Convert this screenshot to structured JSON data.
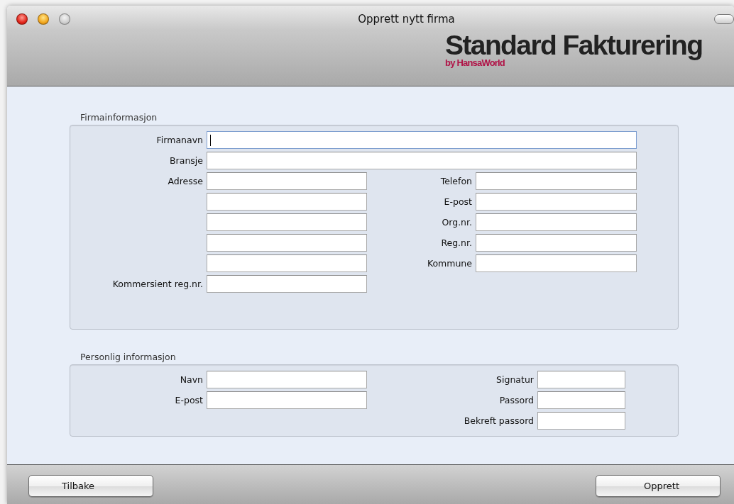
{
  "window": {
    "title": "Opprett nytt firma",
    "logo": {
      "name": "Standard Fakturering",
      "byline": "by HansaWorld"
    }
  },
  "company_info": {
    "title": "Firmainformasjon",
    "wide_fields": [
      {
        "label": "Firmanavn",
        "focused": true
      },
      {
        "label": "Bransje",
        "focused": false
      }
    ],
    "left_fields": [
      {
        "label": "Adresse",
        "kind": "labeled"
      },
      {
        "kind": "blank"
      },
      {
        "kind": "blank"
      },
      {
        "kind": "blank"
      },
      {
        "kind": "blank"
      },
      {
        "label": "Kommersient reg.nr.",
        "kind": "labeled"
      }
    ],
    "right_fields": [
      {
        "label": "Telefon"
      },
      {
        "label": "E-post"
      },
      {
        "label": "Org.nr."
      },
      {
        "label": "Reg.nr."
      },
      {
        "label": "Kommune"
      }
    ]
  },
  "personal_info": {
    "title": "Personlig informasjon",
    "left_fields": [
      {
        "label": "Navn"
      },
      {
        "label": "E-post"
      }
    ],
    "right_fields": [
      {
        "label": "Signatur"
      },
      {
        "label": "Passord"
      },
      {
        "label": "Bekreft passord"
      }
    ]
  },
  "buttons": [
    {
      "label": "Tilbake",
      "kind": "back"
    },
    {
      "label": "Opprett",
      "kind": "create"
    }
  ]
}
